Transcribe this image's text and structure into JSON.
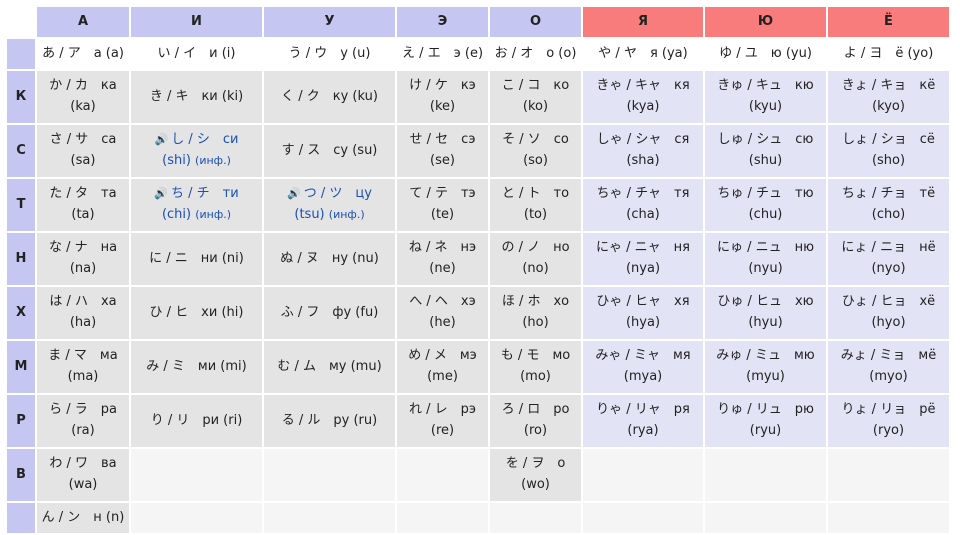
{
  "headers": {
    "a": "А",
    "i": "И",
    "u": "У",
    "e": "Э",
    "o": "О",
    "ya": "Я",
    "yu": "Ю",
    "yo": "Ё"
  },
  "sub": {
    "a": "あ / ア　а (a)",
    "i": "い / イ　и (i)",
    "u": "う / ウ　у (u)",
    "e": "え / エ　э (e)",
    "o": "お / オ　о (o)",
    "ya": "や / ヤ　я (ya)",
    "yu": "ゆ / ユ　ю (yu)",
    "yo": "よ / ヨ　ё (yo)"
  },
  "rows": {
    "k": {
      "label": "К",
      "a": [
        "か / カ　ка",
        "(ka)"
      ],
      "i": "き / キ　ки (ki)",
      "u": "く / ク　ку (ku)",
      "e": [
        "け / ケ　кэ",
        "(ke)"
      ],
      "o": [
        "こ / コ　ко",
        "(ko)"
      ],
      "ya": [
        "きゃ / キャ　кя",
        "(kya)"
      ],
      "yu": [
        "きゅ / キュ　кю",
        "(kyu)"
      ],
      "yo": [
        "きょ / キョ　кё",
        "(kyo)"
      ]
    },
    "s": {
      "label": "С",
      "a": [
        "さ / サ　са",
        "(sa)"
      ],
      "i": [
        "🔊",
        "し / シ　си",
        "(shi)",
        "(инф.)"
      ],
      "u": "す / ス　су (su)",
      "e": [
        "せ / セ　сэ",
        "(se)"
      ],
      "o": [
        "そ / ソ　со",
        "(so)"
      ],
      "ya": [
        "しゃ / シャ　ся",
        "(sha)"
      ],
      "yu": [
        "しゅ / シュ　сю",
        "(shu)"
      ],
      "yo": [
        "しょ / ショ　сё",
        "(sho)"
      ]
    },
    "t": {
      "label": "Т",
      "a": [
        "た / タ　та",
        "(ta)"
      ],
      "i": [
        "🔊",
        "ち / チ　ти",
        "(chi)",
        "(инф.)"
      ],
      "u": [
        "🔊",
        "つ / ツ　цу",
        "(tsu)",
        "(инф.)"
      ],
      "e": [
        "て / テ　тэ",
        "(te)"
      ],
      "o": [
        "と / ト　то",
        "(to)"
      ],
      "ya": [
        "ちゃ / チャ　тя",
        "(cha)"
      ],
      "yu": [
        "ちゅ / チュ　тю",
        "(chu)"
      ],
      "yo": [
        "ちょ / チョ　тё",
        "(cho)"
      ]
    },
    "n": {
      "label": "Н",
      "a": [
        "な / ナ　на",
        "(na)"
      ],
      "i": "に / ニ　ни (ni)",
      "u": "ぬ / ヌ　ну (nu)",
      "e": [
        "ね / ネ　нэ",
        "(ne)"
      ],
      "o": [
        "の / ノ　но",
        "(no)"
      ],
      "ya": [
        "にゃ / ニャ　ня",
        "(nya)"
      ],
      "yu": [
        "にゅ / ニュ　ню",
        "(nyu)"
      ],
      "yo": [
        "にょ / ニョ　нё",
        "(nyo)"
      ]
    },
    "h": {
      "label": "Х",
      "a": [
        "は / ハ　ха",
        "(ha)"
      ],
      "i": "ひ / ヒ　хи (hi)",
      "u": "ふ / フ　фу (fu)",
      "e": [
        "へ / ヘ　хэ",
        "(he)"
      ],
      "o": [
        "ほ / ホ　хо",
        "(ho)"
      ],
      "ya": [
        "ひゃ / ヒャ　хя",
        "(hya)"
      ],
      "yu": [
        "ひゅ / ヒュ　хю",
        "(hyu)"
      ],
      "yo": [
        "ひょ / ヒョ　хё",
        "(hyo)"
      ]
    },
    "m": {
      "label": "М",
      "a": [
        "ま / マ　ма",
        "(ma)"
      ],
      "i": "み / ミ　ми (mi)",
      "u": "む / ム　му (mu)",
      "e": [
        "め / メ　мэ",
        "(me)"
      ],
      "o": [
        "も / モ　мо",
        "(mo)"
      ],
      "ya": [
        "みゃ / ミャ　мя",
        "(mya)"
      ],
      "yu": [
        "みゅ / ミュ　мю",
        "(myu)"
      ],
      "yo": [
        "みょ / ミョ　мё",
        "(myo)"
      ]
    },
    "r": {
      "label": "Р",
      "a": [
        "ら / ラ　ра",
        "(ra)"
      ],
      "i": "り / リ　ри (ri)",
      "u": "る / ル　ру (ru)",
      "e": [
        "れ / レ　рэ",
        "(re)"
      ],
      "o": [
        "ろ / ロ　ро",
        "(ro)"
      ],
      "ya": [
        "りゃ / リャ　ря",
        "(rya)"
      ],
      "yu": [
        "りゅ / リュ　рю",
        "(ryu)"
      ],
      "yo": [
        "りょ / リョ　рё",
        "(ryo)"
      ]
    },
    "w": {
      "label": "В",
      "a": [
        "わ / ワ　ва",
        "(wa)"
      ],
      "o": [
        "を / ヲ　о",
        "(wo)"
      ]
    },
    "nn": {
      "a": "ん / ン　н (n)"
    }
  },
  "colors": {
    "header_blue": "#c5c7f2",
    "header_red": "#f87c7c",
    "cell_gray": "#e4e4e4",
    "cell_purple": "#e3e3f6",
    "link_blue": "#1a4fb5"
  }
}
